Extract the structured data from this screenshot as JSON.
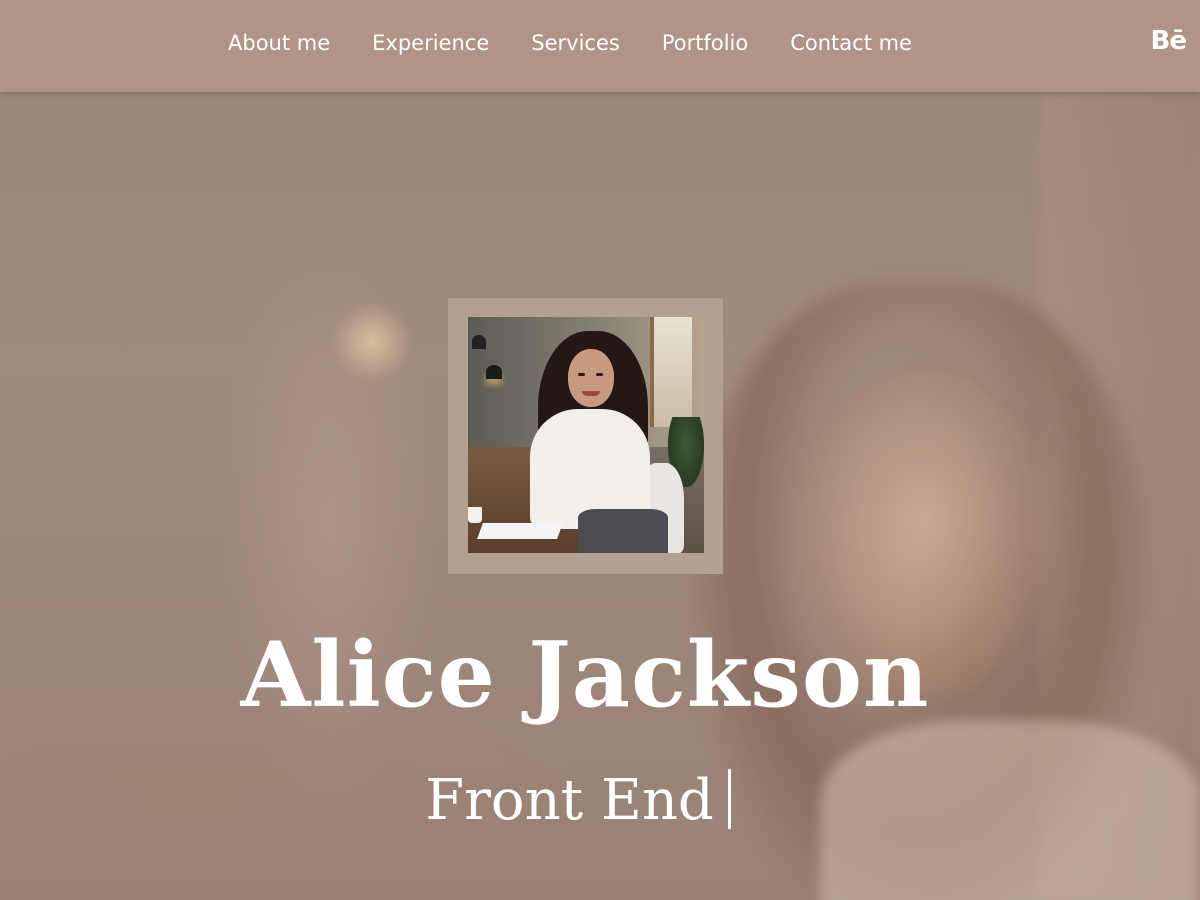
{
  "nav": {
    "links": [
      "About me",
      "Experience",
      "Services",
      "Portfolio",
      "Contact me"
    ],
    "behance_label": "Bē"
  },
  "hero": {
    "name": "Alice Jackson",
    "role": "Front End"
  },
  "icons": {
    "behance": "behance-icon",
    "typing_cursor": "text-cursor"
  },
  "colors": {
    "navbar": "#b09487",
    "frame": "#b4a093",
    "text": "#ffffff"
  }
}
